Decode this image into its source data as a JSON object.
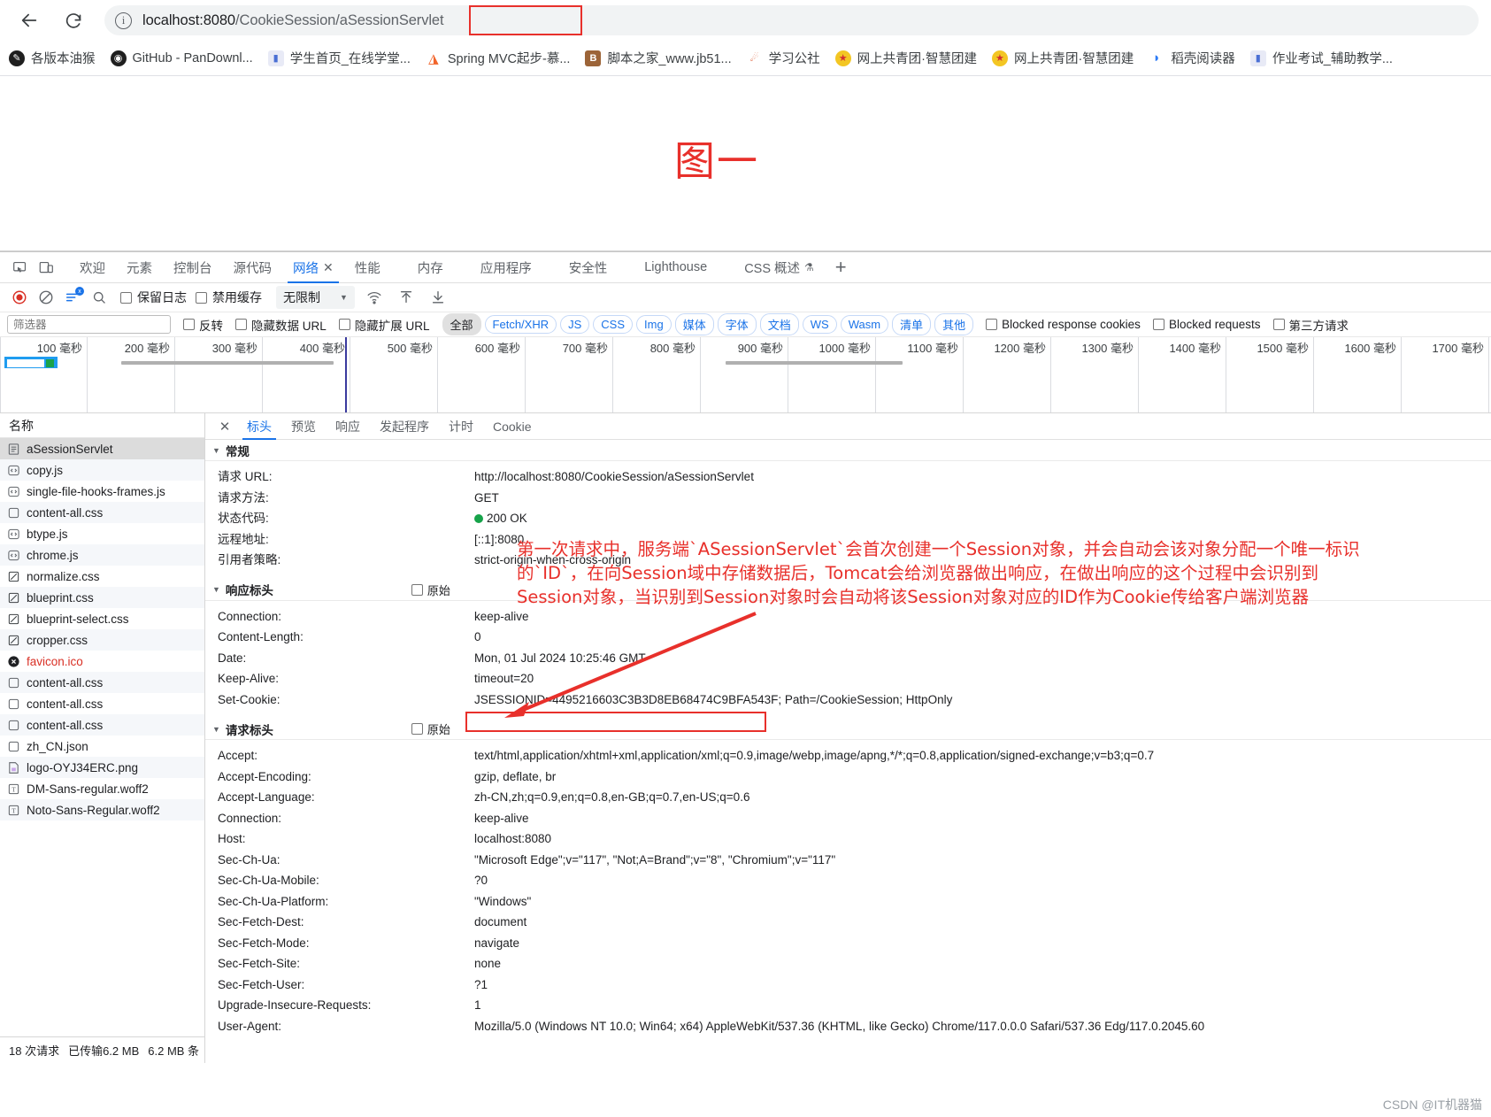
{
  "browser": {
    "back_icon": "back-arrow-icon",
    "reload_icon": "reload-icon",
    "url_info_icon": "info-icon",
    "url_host": "localhost:8080",
    "url_path_1": "/CookieSession",
    "url_path_2": "/aSessionServlet",
    "url_full": "localhost:8080/CookieSession/aSessionServlet",
    "highlight_color": "#e8302b"
  },
  "bookmarks": [
    {
      "label": "各版本油猴",
      "icon": "tampermonkey-icon",
      "color": "#1f1f1f",
      "glyph": "✦"
    },
    {
      "label": "GitHub - PanDownl...",
      "icon": "github-icon",
      "color": "#1f1f1f",
      "glyph": ""
    },
    {
      "label": "学生首页_在线学堂...",
      "icon": "chart-icon",
      "color": "#ffffff",
      "glyph": "▮"
    },
    {
      "label": "Spring MVC起步-慕...",
      "icon": "flame-icon",
      "color": "#ffffff",
      "glyph": "🔥"
    },
    {
      "label": "脚本之家_www.jb51...",
      "icon": "jb51-icon",
      "color": "#8a5a2b",
      "glyph": "B"
    },
    {
      "label": "学习公社",
      "icon": "study-icon",
      "color": "#ffffff",
      "glyph": "🐒"
    },
    {
      "label": "网上共青团·智慧团建",
      "icon": "cyl-icon",
      "color": "#f0c419",
      "glyph": "★"
    },
    {
      "label": "网上共青团·智慧团建",
      "icon": "cyl-icon",
      "color": "#f0c419",
      "glyph": "★"
    },
    {
      "label": "稻壳阅读器",
      "icon": "reader-icon",
      "color": "#2e7cf6",
      "glyph": "◗"
    },
    {
      "label": "作业考试_辅助教学...",
      "icon": "chart-icon",
      "color": "#ffffff",
      "glyph": "▮"
    }
  ],
  "page": {
    "figure_label": "图一"
  },
  "devtools": {
    "left_icons": [
      "inspect-icon",
      "device-toolbar-icon"
    ],
    "tabs": [
      {
        "label": "欢迎",
        "active": false
      },
      {
        "label": "元素",
        "active": false
      },
      {
        "label": "控制台",
        "active": false
      },
      {
        "label": "源代码",
        "active": false
      },
      {
        "label": "网络",
        "active": true,
        "closable": true
      },
      {
        "label": "性能",
        "active": false
      },
      {
        "label": "内存",
        "active": false
      },
      {
        "label": "应用程序",
        "active": false
      },
      {
        "label": "安全性",
        "active": false
      },
      {
        "label": "Lighthouse",
        "active": false
      },
      {
        "label": "CSS 概述",
        "active": false,
        "badge": "beta-flask"
      }
    ],
    "add_tab_label": "+",
    "toolbar": {
      "record_icon": "record-stop-icon",
      "clear_icon": "clear-icon",
      "filter_icon": "filter-icon",
      "search_icon": "search-icon",
      "preserve_log_label": "保留日志",
      "disable_cache_label": "禁用缓存",
      "throttle_value": "无限制",
      "wifi_icon": "network-conditions-icon",
      "import_icon": "import-har-icon",
      "export_icon": "export-har-icon"
    },
    "filterbar": {
      "filter_placeholder": "筛选器",
      "invert_label": "反转",
      "hide_data_urls_label": "隐藏数据 URL",
      "hide_ext_urls_label": "隐藏扩展 URL",
      "types": [
        "全部",
        "Fetch/XHR",
        "JS",
        "CSS",
        "Img",
        "媒体",
        "字体",
        "文档",
        "WS",
        "Wasm",
        "清单",
        "其他"
      ],
      "selected_type": "全部",
      "blocked_response_cookies_label": "Blocked response cookies",
      "blocked_requests_label": "Blocked requests",
      "third_party_label": "第三方请求"
    },
    "overview": {
      "ticks": [
        "100 毫秒",
        "200 毫秒",
        "300 毫秒",
        "400 毫秒",
        "500 毫秒",
        "600 毫秒",
        "700 毫秒",
        "800 毫秒",
        "900 毫秒",
        "1000 毫秒",
        "1100 毫秒",
        "1200 毫秒",
        "1300 毫秒",
        "1400 毫秒",
        "1500 毫秒",
        "1600 毫秒",
        "1700 毫秒"
      ]
    }
  },
  "request_list": {
    "header": "名称",
    "rows": [
      {
        "name": "aSessionServlet",
        "icon": "document-icon",
        "selected": true,
        "error": false
      },
      {
        "name": "copy.js",
        "icon": "script-icon",
        "selected": false,
        "error": false
      },
      {
        "name": "single-file-hooks-frames.js",
        "icon": "script-icon",
        "selected": false,
        "error": false
      },
      {
        "name": "content-all.css",
        "icon": "stylesheet-icon",
        "selected": false,
        "error": false
      },
      {
        "name": "btype.js",
        "icon": "script-icon",
        "selected": false,
        "error": false
      },
      {
        "name": "chrome.js",
        "icon": "script-icon",
        "selected": false,
        "error": false
      },
      {
        "name": "normalize.css",
        "icon": "stylesheet-checked-icon",
        "selected": false,
        "error": false
      },
      {
        "name": "blueprint.css",
        "icon": "stylesheet-checked-icon",
        "selected": false,
        "error": false
      },
      {
        "name": "blueprint-select.css",
        "icon": "stylesheet-checked-icon",
        "selected": false,
        "error": false
      },
      {
        "name": "cropper.css",
        "icon": "stylesheet-checked-icon",
        "selected": false,
        "error": false
      },
      {
        "name": "favicon.ico",
        "icon": "error-icon",
        "selected": false,
        "error": true
      },
      {
        "name": "content-all.css",
        "icon": "stylesheet-icon",
        "selected": false,
        "error": false
      },
      {
        "name": "content-all.css",
        "icon": "stylesheet-icon",
        "selected": false,
        "error": false
      },
      {
        "name": "content-all.css",
        "icon": "stylesheet-icon",
        "selected": false,
        "error": false
      },
      {
        "name": "zh_CN.json",
        "icon": "stylesheet-icon",
        "selected": false,
        "error": false
      },
      {
        "name": "logo-OYJ34ERC.png",
        "icon": "image-icon",
        "selected": false,
        "error": false
      },
      {
        "name": "DM-Sans-regular.woff2",
        "icon": "font-icon",
        "selected": false,
        "error": false
      },
      {
        "name": "Noto-Sans-Regular.woff2",
        "icon": "font-icon",
        "selected": false,
        "error": false
      }
    ],
    "status": {
      "requests": "18 次请求",
      "transferred": "已传输6.2 MB",
      "resources": "6.2 MB 条"
    }
  },
  "detail": {
    "close_icon": "close-icon",
    "tabs": [
      {
        "label": "标头",
        "active": true
      },
      {
        "label": "预览",
        "active": false
      },
      {
        "label": "响应",
        "active": false
      },
      {
        "label": "发起程序",
        "active": false
      },
      {
        "label": "计时",
        "active": false
      },
      {
        "label": "Cookie",
        "active": false
      }
    ],
    "general": {
      "title": "常规",
      "rows": [
        {
          "key": "请求 URL:",
          "value": "http://localhost:8080/CookieSession/aSessionServlet"
        },
        {
          "key": "请求方法:",
          "value": "GET"
        },
        {
          "key": "状态代码:",
          "value": "200 OK",
          "status_dot": true
        },
        {
          "key": "远程地址:",
          "value": "[::1]:8080"
        },
        {
          "key": "引用者策略:",
          "value": "strict-origin-when-cross-origin"
        }
      ]
    },
    "response_headers": {
      "title": "响应标头",
      "raw_label": "原始",
      "rows": [
        {
          "key": "Connection:",
          "value": "keep-alive"
        },
        {
          "key": "Content-Length:",
          "value": "0"
        },
        {
          "key": "Date:",
          "value": "Mon, 01 Jul 2024 10:25:46 GMT"
        },
        {
          "key": "Keep-Alive:",
          "value": "timeout=20"
        },
        {
          "key": "Set-Cookie:",
          "value": "JSESSIONID=4495216603C3B3D8EB68474C9BFA543F; Path=/CookieSession; HttpOnly"
        }
      ]
    },
    "request_headers": {
      "title": "请求标头",
      "raw_label": "原始",
      "rows": [
        {
          "key": "Accept:",
          "value": "text/html,application/xhtml+xml,application/xml;q=0.9,image/webp,image/apng,*/*;q=0.8,application/signed-exchange;v=b3;q=0.7"
        },
        {
          "key": "Accept-Encoding:",
          "value": "gzip, deflate, br"
        },
        {
          "key": "Accept-Language:",
          "value": "zh-CN,zh;q=0.9,en;q=0.8,en-GB;q=0.7,en-US;q=0.6"
        },
        {
          "key": "Connection:",
          "value": "keep-alive"
        },
        {
          "key": "Host:",
          "value": "localhost:8080"
        },
        {
          "key": "Sec-Ch-Ua:",
          "value": "\"Microsoft Edge\";v=\"117\", \"Not;A=Brand\";v=\"8\", \"Chromium\";v=\"117\""
        },
        {
          "key": "Sec-Ch-Ua-Mobile:",
          "value": "?0"
        },
        {
          "key": "Sec-Ch-Ua-Platform:",
          "value": "\"Windows\""
        },
        {
          "key": "Sec-Fetch-Dest:",
          "value": "document"
        },
        {
          "key": "Sec-Fetch-Mode:",
          "value": "navigate"
        },
        {
          "key": "Sec-Fetch-Site:",
          "value": "none"
        },
        {
          "key": "Sec-Fetch-User:",
          "value": "?1"
        },
        {
          "key": "Upgrade-Insecure-Requests:",
          "value": "1"
        },
        {
          "key": "User-Agent:",
          "value": "Mozilla/5.0 (Windows NT 10.0; Win64; x64) AppleWebKit/537.36 (KHTML, like Gecko) Chrome/117.0.0.0 Safari/537.36 Edg/117.0.2045.60"
        }
      ]
    }
  },
  "annotation": {
    "text": "第一次请求中，服务端`ASessionServlet`会首次创建一个Session对象，并会自动会该对象分配一个唯一标识的`ID`，在向Session域中存储数据后，Tomcat会给浏览器做出响应，在做出响应的这个过程中会识别到Session对象，当识别到Session对象时会自动将该Session对象对应的ID作为Cookie传给客户端浏览器",
    "color": "#e8302b"
  },
  "watermark": "CSDN @IT机器猫"
}
